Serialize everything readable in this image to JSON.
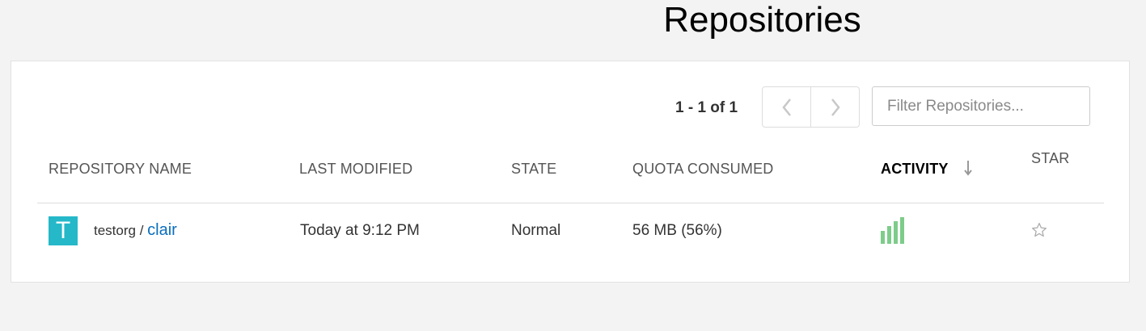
{
  "page": {
    "title": "Repositories"
  },
  "pagination": {
    "summary": "1 - 1 of 1",
    "prev_icon": "chevron-left-icon",
    "next_icon": "chevron-right-icon"
  },
  "filter": {
    "placeholder": "Filter Repositories...",
    "value": ""
  },
  "table": {
    "columns": [
      {
        "label": "REPOSITORY NAME"
      },
      {
        "label": "LAST MODIFIED"
      },
      {
        "label": "STATE"
      },
      {
        "label": "QUOTA CONSUMED"
      },
      {
        "label": "ACTIVITY",
        "sorted": true,
        "sort_icon": "arrow-down-icon"
      },
      {
        "label": "STAR"
      }
    ],
    "rows": [
      {
        "avatar_letter": "T",
        "avatar_color": "#25b8c9",
        "namespace": "testorg",
        "separator": " / ",
        "name": "clair",
        "last_modified": "Today at 9:12 PM",
        "state": "Normal",
        "quota": "56 MB (56%)",
        "activity_icon": "activity-bars-icon",
        "activity_color": "#7dcc8a",
        "starred": false,
        "star_icon": "star-outline-icon"
      }
    ]
  },
  "colors": {
    "link": "#0a6ebd",
    "background": "#f3f3f3"
  }
}
